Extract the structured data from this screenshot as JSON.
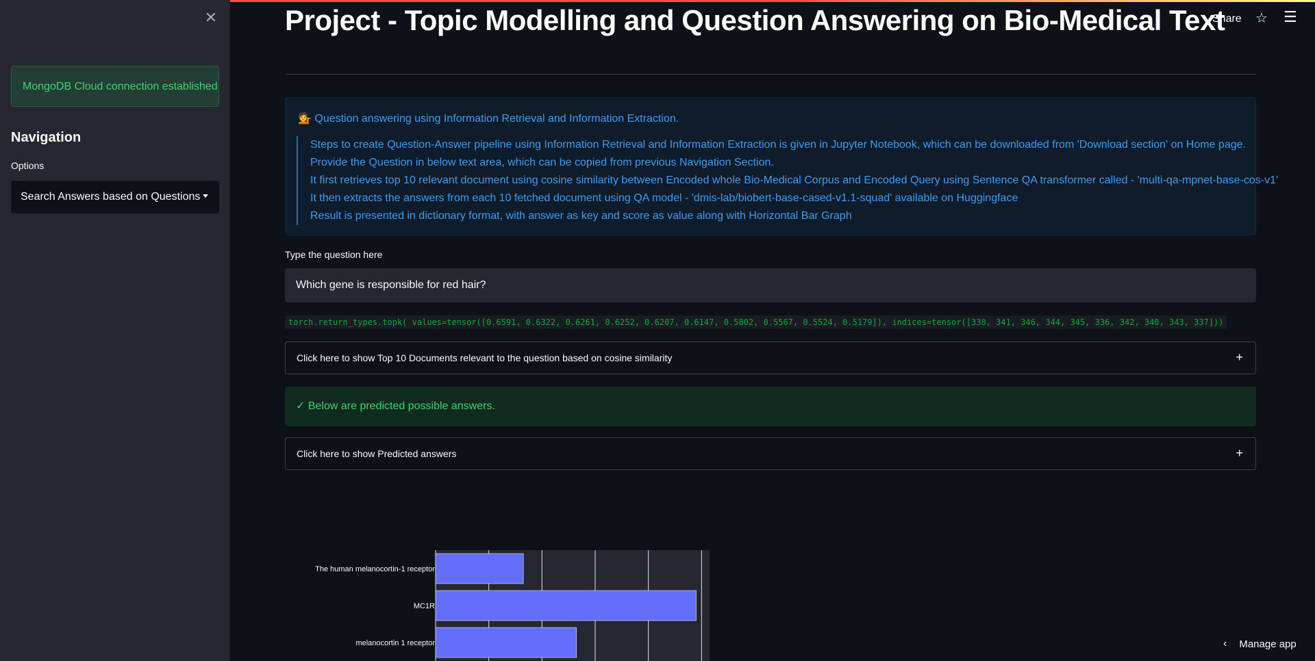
{
  "sidebar": {
    "close_icon": "✕",
    "connection_message": "MongoDB Cloud connection established",
    "navigation_heading": "Navigation",
    "options_label": "Options",
    "selected_option": "Search Answers based on Questions"
  },
  "header": {
    "title": "Project - Topic Modelling and Question Answering on Bio-Medical Text",
    "share_label": "Share",
    "star_icon": "☆",
    "menu_icon": "☰"
  },
  "info": {
    "title": "💁 Question answering using Information Retrieval and Information Extraction.",
    "steps": [
      "Steps to create Question-Answer pipeline using Information Retrieval and Information Extraction is given in Jupyter Notebook, which can be downloaded from 'Download section' on Home page.",
      "Provide the Question in below text area, which can be copied from previous Navigation Section.",
      "It first retrieves top 10 relevant document using cosine similarity between Encoded whole Bio-Medical Corpus and Encoded Query using Sentence QA transformer called - 'multi-qa-mpnet-base-cos-v1'",
      "It then extracts the answers from each 10 fetched document using QA model - 'dmis-lab/biobert-base-cased-v1.1-squad' available on Huggingface",
      "Result is presented in dictionary format, with answer as key and score as value along with Horizontal Bar Graph"
    ]
  },
  "question": {
    "label": "Type the question here",
    "value": "Which gene is responsible for red hair?"
  },
  "code_output": "torch.return_types.topk( values=tensor([0.6591, 0.6322, 0.6261, 0.6252, 0.6207, 0.6147, 0.5802, 0.5567, 0.5524, 0.5179]), indices=tensor([338, 341, 346, 344, 345, 336, 342, 340, 343, 337]))",
  "expanders": {
    "top_docs": "Click here to show Top 10 Documents relevant to the question based on cosine similarity",
    "predicted": "Click here to show Predicted answers",
    "plus_icon": "+"
  },
  "success_message": "✓ Below are predicted possible answers.",
  "footer": {
    "manage_app_label": "Manage app",
    "chevron_icon": "‹"
  },
  "colors": {
    "bar_fill": "#636efa",
    "plot_bg": "#262730",
    "grid": "#e5e5e5"
  },
  "chart_data": {
    "type": "bar",
    "orientation": "horizontal",
    "categories": [
      "The human melanocortin-1 receptor",
      "MC1R",
      "melanocortin 1 receptor"
    ],
    "values": [
      0.33,
      0.98,
      0.53
    ],
    "xlim": [
      0,
      1.03
    ],
    "grid": true
  }
}
